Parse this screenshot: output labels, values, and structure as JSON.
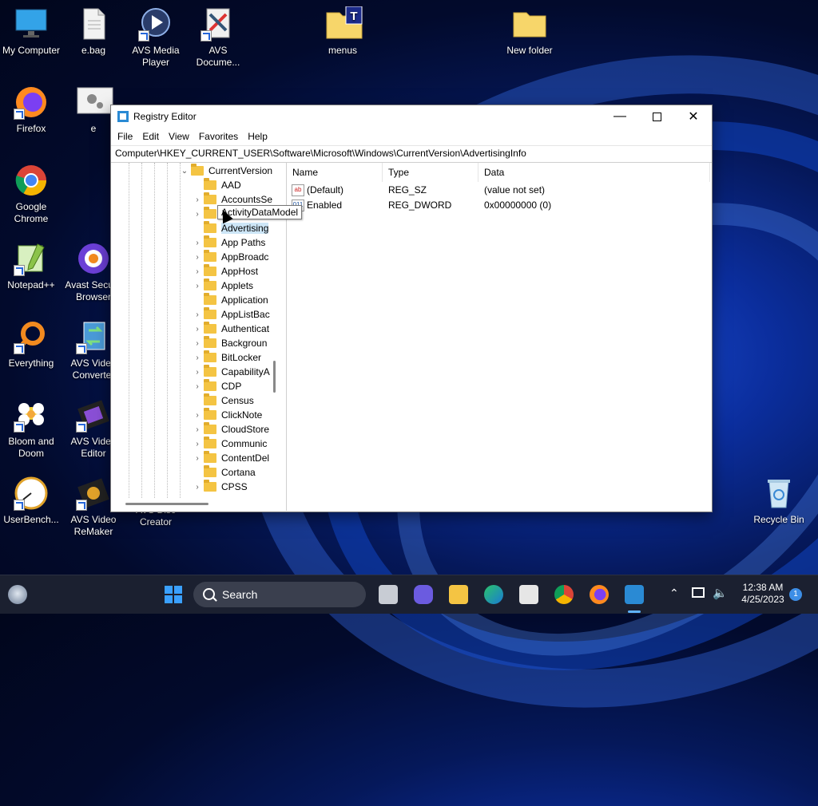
{
  "desktop": {
    "icons": [
      {
        "label": "My Computer",
        "icon": "monitor-icon"
      },
      {
        "label": "e.bag",
        "icon": "file-icon"
      },
      {
        "label": "AVS Media Player",
        "icon": "avs-player-icon"
      },
      {
        "label": "AVS Docume...",
        "icon": "avs-document-icon"
      },
      {
        "label": "menus",
        "icon": "folder-icon"
      },
      {
        "label": "New folder",
        "icon": "folder-icon"
      },
      {
        "label": "Firefox",
        "icon": "firefox-icon"
      },
      {
        "label": "e",
        "icon": "settings-file-icon"
      },
      {
        "label": "Google Chrome",
        "icon": "chrome-icon"
      },
      {
        "label": "Notepad++",
        "icon": "notepadpp-icon"
      },
      {
        "label": "Avast Secure Browser",
        "icon": "avast-icon"
      },
      {
        "label": "Everything",
        "icon": "everything-icon"
      },
      {
        "label": "AVS Video Converter",
        "icon": "avs-converter-icon"
      },
      {
        "label": "Bloom and Doom",
        "icon": "bloom-doom-icon"
      },
      {
        "label": "AVS Video Editor",
        "icon": "avs-editor-icon"
      },
      {
        "label": "UserBench...",
        "icon": "userbench-icon"
      },
      {
        "label": "AVS Video ReMaker",
        "icon": "avs-remaker-icon"
      },
      {
        "label": "AVS Disc Creator",
        "icon": "avs-disc-icon"
      },
      {
        "label": "Recycle Bin",
        "icon": "recycle-bin-icon"
      }
    ]
  },
  "regedit": {
    "title": "Registry Editor",
    "menu": [
      "File",
      "Edit",
      "View",
      "Favorites",
      "Help"
    ],
    "address": "Computer\\HKEY_CURRENT_USER\\Software\\Microsoft\\Windows\\CurrentVersion\\AdvertisingInfo",
    "tree": {
      "parent": "CurrentVersion",
      "items": [
        {
          "label": "AAD",
          "expandable": false
        },
        {
          "label": "AccountsSe",
          "expandable": true
        },
        {
          "label": "ActivityDataModel",
          "expandable": true
        },
        {
          "label": "Advertising",
          "expandable": false,
          "selected": true
        },
        {
          "label": "App Paths",
          "expandable": true
        },
        {
          "label": "AppBroadc",
          "expandable": true
        },
        {
          "label": "AppHost",
          "expandable": true
        },
        {
          "label": "Applets",
          "expandable": true
        },
        {
          "label": "Application",
          "expandable": false
        },
        {
          "label": "AppListBac",
          "expandable": true
        },
        {
          "label": "Authenticat",
          "expandable": true
        },
        {
          "label": "Backgroun",
          "expandable": true
        },
        {
          "label": "BitLocker",
          "expandable": true
        },
        {
          "label": "CapabilityA",
          "expandable": true
        },
        {
          "label": "CDP",
          "expandable": true
        },
        {
          "label": "Census",
          "expandable": false
        },
        {
          "label": "ClickNote",
          "expandable": true
        },
        {
          "label": "CloudStore",
          "expandable": true
        },
        {
          "label": "Communic",
          "expandable": true
        },
        {
          "label": "ContentDel",
          "expandable": true
        },
        {
          "label": "Cortana",
          "expandable": false
        },
        {
          "label": "CPSS",
          "expandable": true
        }
      ],
      "tooltip": "ActivityDataModel"
    },
    "columns": [
      "Name",
      "Type",
      "Data"
    ],
    "values": [
      {
        "name": "(Default)",
        "type": "REG_SZ",
        "data": "(value not set)",
        "icon": "string-value-icon"
      },
      {
        "name": "Enabled",
        "type": "REG_DWORD",
        "data": "0x00000000 (0)",
        "icon": "binary-value-icon"
      }
    ]
  },
  "taskbar": {
    "search_label": "Search",
    "time": "12:38 AM",
    "date": "4/25/2023",
    "notification_count": "1"
  }
}
